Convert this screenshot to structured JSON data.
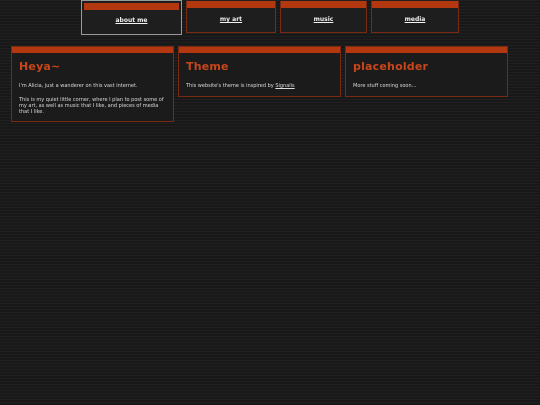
{
  "nav": {
    "tabs": [
      {
        "label": "about me",
        "active": true
      },
      {
        "label": "my art",
        "active": false
      },
      {
        "label": "music",
        "active": false
      },
      {
        "label": "media",
        "active": false
      }
    ]
  },
  "cards": [
    {
      "title": "Heya~",
      "paragraphs": [
        "I'm Alicia, just a wanderer on this vast internet.",
        "This is my quiet little corner, where I plan to post some of my art, as well as music that I like, and pieces of media that I like."
      ]
    },
    {
      "title": "Theme",
      "text_before_link": "This website's theme is inspired by ",
      "link_text": "Signalis"
    },
    {
      "title": "placeholder",
      "paragraphs": [
        "More stuff coming soon..."
      ]
    }
  ],
  "colors": {
    "accent": "#b3380f",
    "title": "#c9461a",
    "border": "#7a2a10",
    "background": "#1c1c1c",
    "text": "#dcdcdc"
  }
}
